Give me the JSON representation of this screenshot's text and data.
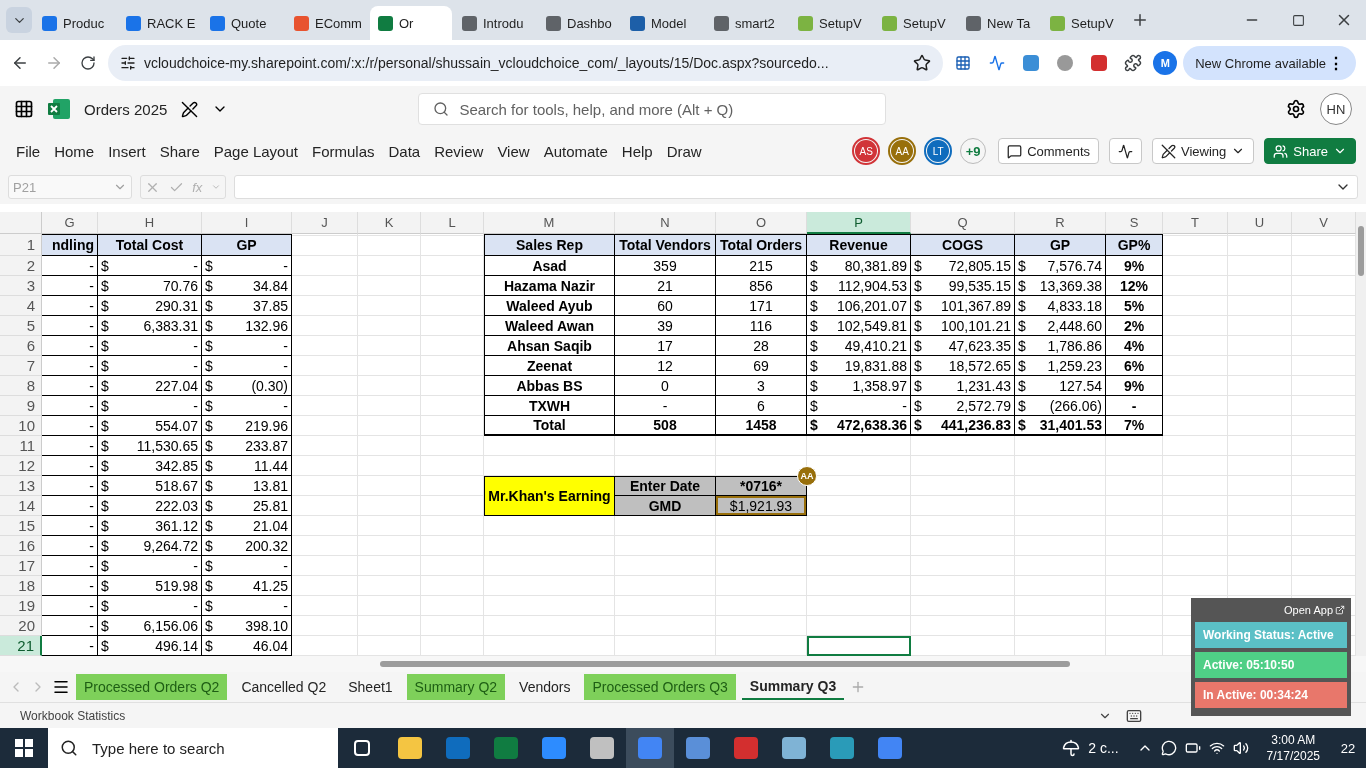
{
  "browser": {
    "tabs": [
      {
        "label": "Produc",
        "color": "#1a73e8",
        "selected": false
      },
      {
        "label": "RACK E",
        "color": "#1a73e8",
        "selected": false
      },
      {
        "label": "Quote",
        "color": "#1a73e8",
        "selected": false
      },
      {
        "label": "EComm",
        "color": "#e8532f",
        "selected": false
      },
      {
        "label": "Or",
        "color": "#107c41",
        "selected": true
      },
      {
        "label": "Introdu",
        "color": "#5f6368",
        "selected": false
      },
      {
        "label": "Dashbo",
        "color": "#5f6368",
        "selected": false
      },
      {
        "label": "Model",
        "color": "#1d5fa8",
        "selected": false
      },
      {
        "label": "smart2",
        "color": "#5f6368",
        "selected": false
      },
      {
        "label": "SetupV",
        "color": "#7cb342",
        "selected": false
      },
      {
        "label": "SetupV",
        "color": "#7cb342",
        "selected": false
      },
      {
        "label": "New Ta",
        "color": "#5f6368",
        "selected": false
      },
      {
        "label": "SetupV",
        "color": "#7cb342",
        "selected": false
      }
    ],
    "url": "vcloudchoice-my.sharepoint.com/:x:/r/personal/shussain_vcloudchoice_com/_layouts/15/Doc.aspx?sourcedo...",
    "profile": "M",
    "update_button": "New Chrome available",
    "update_menu": "⋮"
  },
  "app": {
    "title": "Orders 2025",
    "search_placeholder": "Search for tools, help, and more (Alt + Q)",
    "user": "HN"
  },
  "menu": [
    "File",
    "Home",
    "Insert",
    "Share",
    "Page Layout",
    "Formulas",
    "Data",
    "Review",
    "View",
    "Automate",
    "Help",
    "Draw"
  ],
  "collaborators": [
    {
      "initials": "AS",
      "color": "#d13438"
    },
    {
      "initials": "AA",
      "color": "#986f0b"
    },
    {
      "initials": "LT",
      "color": "#0f6cbd"
    }
  ],
  "more_collaborators": "+9",
  "toolbar": {
    "comments": "Comments",
    "mode": "Viewing",
    "share": "Share"
  },
  "formula_bar": {
    "name_box": "P21",
    "fx": "fx"
  },
  "sheet": {
    "columns": [
      {
        "letter": "G",
        "selected": false
      },
      {
        "letter": "H",
        "selected": false
      },
      {
        "letter": "I",
        "selected": false
      },
      {
        "letter": "J",
        "selected": false
      },
      {
        "letter": "K",
        "selected": false
      },
      {
        "letter": "L",
        "selected": false
      },
      {
        "letter": "M",
        "selected": false
      },
      {
        "letter": "N",
        "selected": false
      },
      {
        "letter": "O",
        "selected": false
      },
      {
        "letter": "P",
        "selected": true
      },
      {
        "letter": "Q",
        "selected": false
      },
      {
        "letter": "R",
        "selected": false
      },
      {
        "letter": "S",
        "selected": false
      },
      {
        "letter": "T",
        "selected": false
      },
      {
        "letter": "U",
        "selected": false
      },
      {
        "letter": "V",
        "selected": false
      }
    ],
    "rows": [
      {
        "number": "1",
        "selected": false
      },
      {
        "number": "2",
        "selected": false
      },
      {
        "number": "3",
        "selected": false
      },
      {
        "number": "4",
        "selected": false
      },
      {
        "number": "5",
        "selected": false
      },
      {
        "number": "6",
        "selected": false
      },
      {
        "number": "7",
        "selected": false
      },
      {
        "number": "8",
        "selected": false
      },
      {
        "number": "9",
        "selected": false
      },
      {
        "number": "10",
        "selected": false
      },
      {
        "number": "11",
        "selected": false
      },
      {
        "number": "12",
        "selected": false
      },
      {
        "number": "13",
        "selected": false
      },
      {
        "number": "14",
        "selected": false
      },
      {
        "number": "15",
        "selected": false
      },
      {
        "number": "16",
        "selected": false
      },
      {
        "number": "17",
        "selected": false
      },
      {
        "number": "18",
        "selected": false
      },
      {
        "number": "19",
        "selected": false
      },
      {
        "number": "20",
        "selected": false
      },
      {
        "number": "21",
        "selected": true
      }
    ],
    "left_table": {
      "headers": [
        "ndling",
        "Total Cost",
        "GP"
      ],
      "rows": [
        [
          "-",
          [
            "$",
            "-"
          ],
          [
            "$",
            "-"
          ]
        ],
        [
          "-",
          [
            "$",
            "70.76"
          ],
          [
            "$",
            "34.84"
          ]
        ],
        [
          "-",
          [
            "$",
            "290.31"
          ],
          [
            "$",
            "37.85"
          ]
        ],
        [
          "-",
          [
            "$",
            "6,383.31"
          ],
          [
            "$",
            "132.96"
          ]
        ],
        [
          "-",
          [
            "$",
            "-"
          ],
          [
            "$",
            "-"
          ]
        ],
        [
          "-",
          [
            "$",
            "-"
          ],
          [
            "$",
            "-"
          ]
        ],
        [
          "-",
          [
            "$",
            "227.04"
          ],
          [
            "$",
            "(0.30)"
          ]
        ],
        [
          "-",
          [
            "$",
            "-"
          ],
          [
            "$",
            "-"
          ]
        ],
        [
          "-",
          [
            "$",
            "554.07"
          ],
          [
            "$",
            "219.96"
          ]
        ],
        [
          "-",
          [
            "$",
            "11,530.65"
          ],
          [
            "$",
            "233.87"
          ]
        ],
        [
          "-",
          [
            "$",
            "342.85"
          ],
          [
            "$",
            "11.44"
          ]
        ],
        [
          "-",
          [
            "$",
            "518.67"
          ],
          [
            "$",
            "13.81"
          ]
        ],
        [
          "-",
          [
            "$",
            "222.03"
          ],
          [
            "$",
            "25.81"
          ]
        ],
        [
          "-",
          [
            "$",
            "361.12"
          ],
          [
            "$",
            "21.04"
          ]
        ],
        [
          "-",
          [
            "$",
            "9,264.72"
          ],
          [
            "$",
            "200.32"
          ]
        ],
        [
          "-",
          [
            "$",
            "-"
          ],
          [
            "$",
            "-"
          ]
        ],
        [
          "-",
          [
            "$",
            "519.98"
          ],
          [
            "$",
            "41.25"
          ]
        ],
        [
          "-",
          [
            "$",
            "-"
          ],
          [
            "$",
            "-"
          ]
        ],
        [
          "-",
          [
            "$",
            "6,156.06"
          ],
          [
            "$",
            "398.10"
          ]
        ],
        [
          "-",
          [
            "$",
            "496.14"
          ],
          [
            "$",
            "46.04"
          ]
        ]
      ]
    },
    "summary_table": {
      "headers": [
        "Sales Rep",
        "Total Vendors",
        "Total Orders",
        "Revenue",
        "COGS",
        "GP",
        "GP%"
      ],
      "rows": [
        [
          "Asad",
          "359",
          "215",
          [
            "$",
            "80,381.89"
          ],
          [
            "$",
            "72,805.15"
          ],
          [
            "$",
            "7,576.74"
          ],
          "9%"
        ],
        [
          "Hazama Nazir",
          "21",
          "856",
          [
            "$",
            "112,904.53"
          ],
          [
            "$",
            "99,535.15"
          ],
          [
            "$",
            "13,369.38"
          ],
          "12%"
        ],
        [
          "Waleed Ayub",
          "60",
          "171",
          [
            "$",
            "106,201.07"
          ],
          [
            "$",
            "101,367.89"
          ],
          [
            "$",
            "4,833.18"
          ],
          "5%"
        ],
        [
          "Waleed Awan",
          "39",
          "116",
          [
            "$",
            "102,549.81"
          ],
          [
            "$",
            "100,101.21"
          ],
          [
            "$",
            "2,448.60"
          ],
          "2%"
        ],
        [
          "Ahsan Saqib",
          "17",
          "28",
          [
            "$",
            "49,410.21"
          ],
          [
            "$",
            "47,623.35"
          ],
          [
            "$",
            "1,786.86"
          ],
          "4%"
        ],
        [
          "Zeenat",
          "12",
          "69",
          [
            "$",
            "19,831.88"
          ],
          [
            "$",
            "18,572.65"
          ],
          [
            "$",
            "1,259.23"
          ],
          "6%"
        ],
        [
          "Abbas BS",
          "0",
          "3",
          [
            "$",
            "1,358.97"
          ],
          [
            "$",
            "1,231.43"
          ],
          [
            "$",
            "127.54"
          ],
          "9%"
        ],
        [
          "TXWH",
          "-",
          "6",
          [
            "$",
            "-"
          ],
          [
            "$",
            "2,572.79"
          ],
          [
            "$",
            "(266.06)"
          ],
          "-"
        ]
      ],
      "total": [
        "Total",
        "508",
        "1458",
        [
          "$",
          "472,638.36"
        ],
        [
          "$",
          "441,236.83"
        ],
        [
          "$",
          "31,401.53"
        ],
        "7%"
      ]
    },
    "earning": {
      "title": "Mr.Khan's Earning",
      "date_label": "Enter Date",
      "date_value": "*0716*",
      "gmd_label": "GMD",
      "gmd_value": "$1,921.93",
      "editor": {
        "initials": "AA",
        "color": "#986f0b"
      }
    }
  },
  "sheet_tabs": [
    {
      "label": "Processed Orders Q2",
      "color": "#7ed05a",
      "selected": false
    },
    {
      "label": "Cancelled Q2",
      "selected": false
    },
    {
      "label": "Sheet1",
      "selected": false
    },
    {
      "label": "Summary Q2",
      "color": "#7ed05a",
      "selected": false
    },
    {
      "label": "Vendors",
      "selected": false
    },
    {
      "label": "Processed Orders Q3",
      "color": "#7ed05a",
      "selected": false
    },
    {
      "label": "Summary Q3",
      "selected": true
    }
  ],
  "status_bar": {
    "text": "Workbook Statistics"
  },
  "tracker": {
    "open_app": "Open App",
    "status": "Working Status: Active",
    "active": "Active: 05:10:50",
    "inactive": "In Active: 00:34:24"
  },
  "taskbar": {
    "search_placeholder": "Type here to search",
    "weather": "2 c...",
    "time": "3:00 AM",
    "date": "7/17/2025",
    "notifications": "22"
  }
}
